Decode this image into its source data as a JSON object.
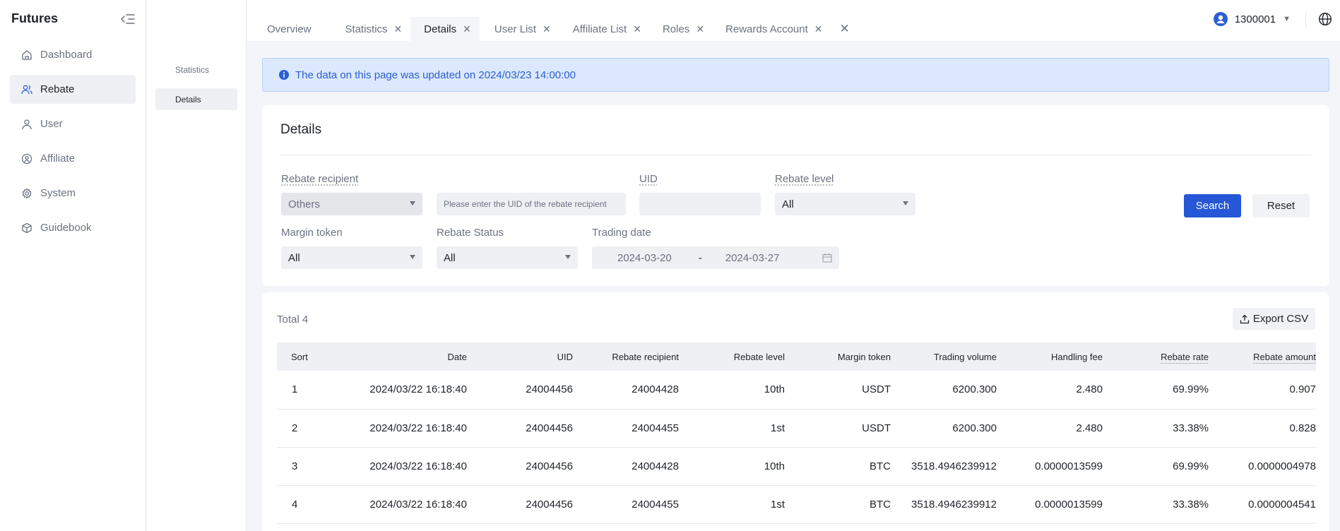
{
  "sidebar": {
    "brand": "Futures",
    "items": [
      {
        "label": "Dashboard",
        "icon": "home-icon"
      },
      {
        "label": "Rebate",
        "icon": "users-icon",
        "active": true
      },
      {
        "label": "User",
        "icon": "user-icon"
      },
      {
        "label": "Affiliate",
        "icon": "affiliate-icon"
      },
      {
        "label": "System",
        "icon": "gear-icon"
      },
      {
        "label": "Guidebook",
        "icon": "cube-icon"
      }
    ]
  },
  "subnav": {
    "items": [
      {
        "label": "Statistics"
      },
      {
        "label": "Details",
        "active": true
      }
    ]
  },
  "tabs": [
    {
      "label": "Overview"
    },
    {
      "label": "Statistics"
    },
    {
      "label": "Details",
      "active": true
    },
    {
      "label": "User List"
    },
    {
      "label": "Affiliate List"
    },
    {
      "label": "Roles"
    },
    {
      "label": "Rewards Account"
    }
  ],
  "user": {
    "id": "1300001"
  },
  "banner": {
    "text": "The data on this page was updated on 2024/03/23 14:00:00"
  },
  "filter": {
    "title": "Details",
    "rebate_recipient_label": "Rebate recipient",
    "rebate_recipient_value": "Others",
    "recipient_uid_placeholder": "Please enter the UID of the rebate recipient",
    "uid_label": "UID",
    "uid_value": "",
    "rebate_level_label": "Rebate level",
    "rebate_level_value": "All",
    "margin_token_label": "Margin token",
    "margin_token_value": "All",
    "rebate_status_label": "Rebate Status",
    "rebate_status_value": "All",
    "trading_date_label": "Trading date",
    "date_start": "2024-03-20",
    "date_separator": "-",
    "date_end": "2024-03-27",
    "search_label": "Search",
    "reset_label": "Reset"
  },
  "table": {
    "total": "Total 4",
    "export_label": "Export CSV",
    "columns": [
      "Sort",
      "Date",
      "UID",
      "Rebate recipient",
      "Rebate level",
      "Margin token",
      "Trading volume",
      "Handling fee",
      "Rebate rate",
      "Rebate amount"
    ],
    "rows": [
      [
        "1",
        "2024/03/22 16:18:40",
        "24004456",
        "24004428",
        "10th",
        "USDT",
        "6200.300",
        "2.480",
        "69.99%",
        "0.907"
      ],
      [
        "2",
        "2024/03/22 16:18:40",
        "24004456",
        "24004455",
        "1st",
        "USDT",
        "6200.300",
        "2.480",
        "33.38%",
        "0.828"
      ],
      [
        "3",
        "2024/03/22 16:18:40",
        "24004456",
        "24004428",
        "10th",
        "BTC",
        "3518.4946239912",
        "0.0000013599",
        "69.99%",
        "0.0000004978"
      ],
      [
        "4",
        "2024/03/22 16:18:40",
        "24004456",
        "24004455",
        "1st",
        "BTC",
        "3518.4946239912",
        "0.0000013599",
        "33.38%",
        "0.0000004541"
      ]
    ]
  },
  "colors": {
    "accent": "#2557d6",
    "banner_bg": "#dbe8fd",
    "banner_text": "#2c5fd3"
  }
}
